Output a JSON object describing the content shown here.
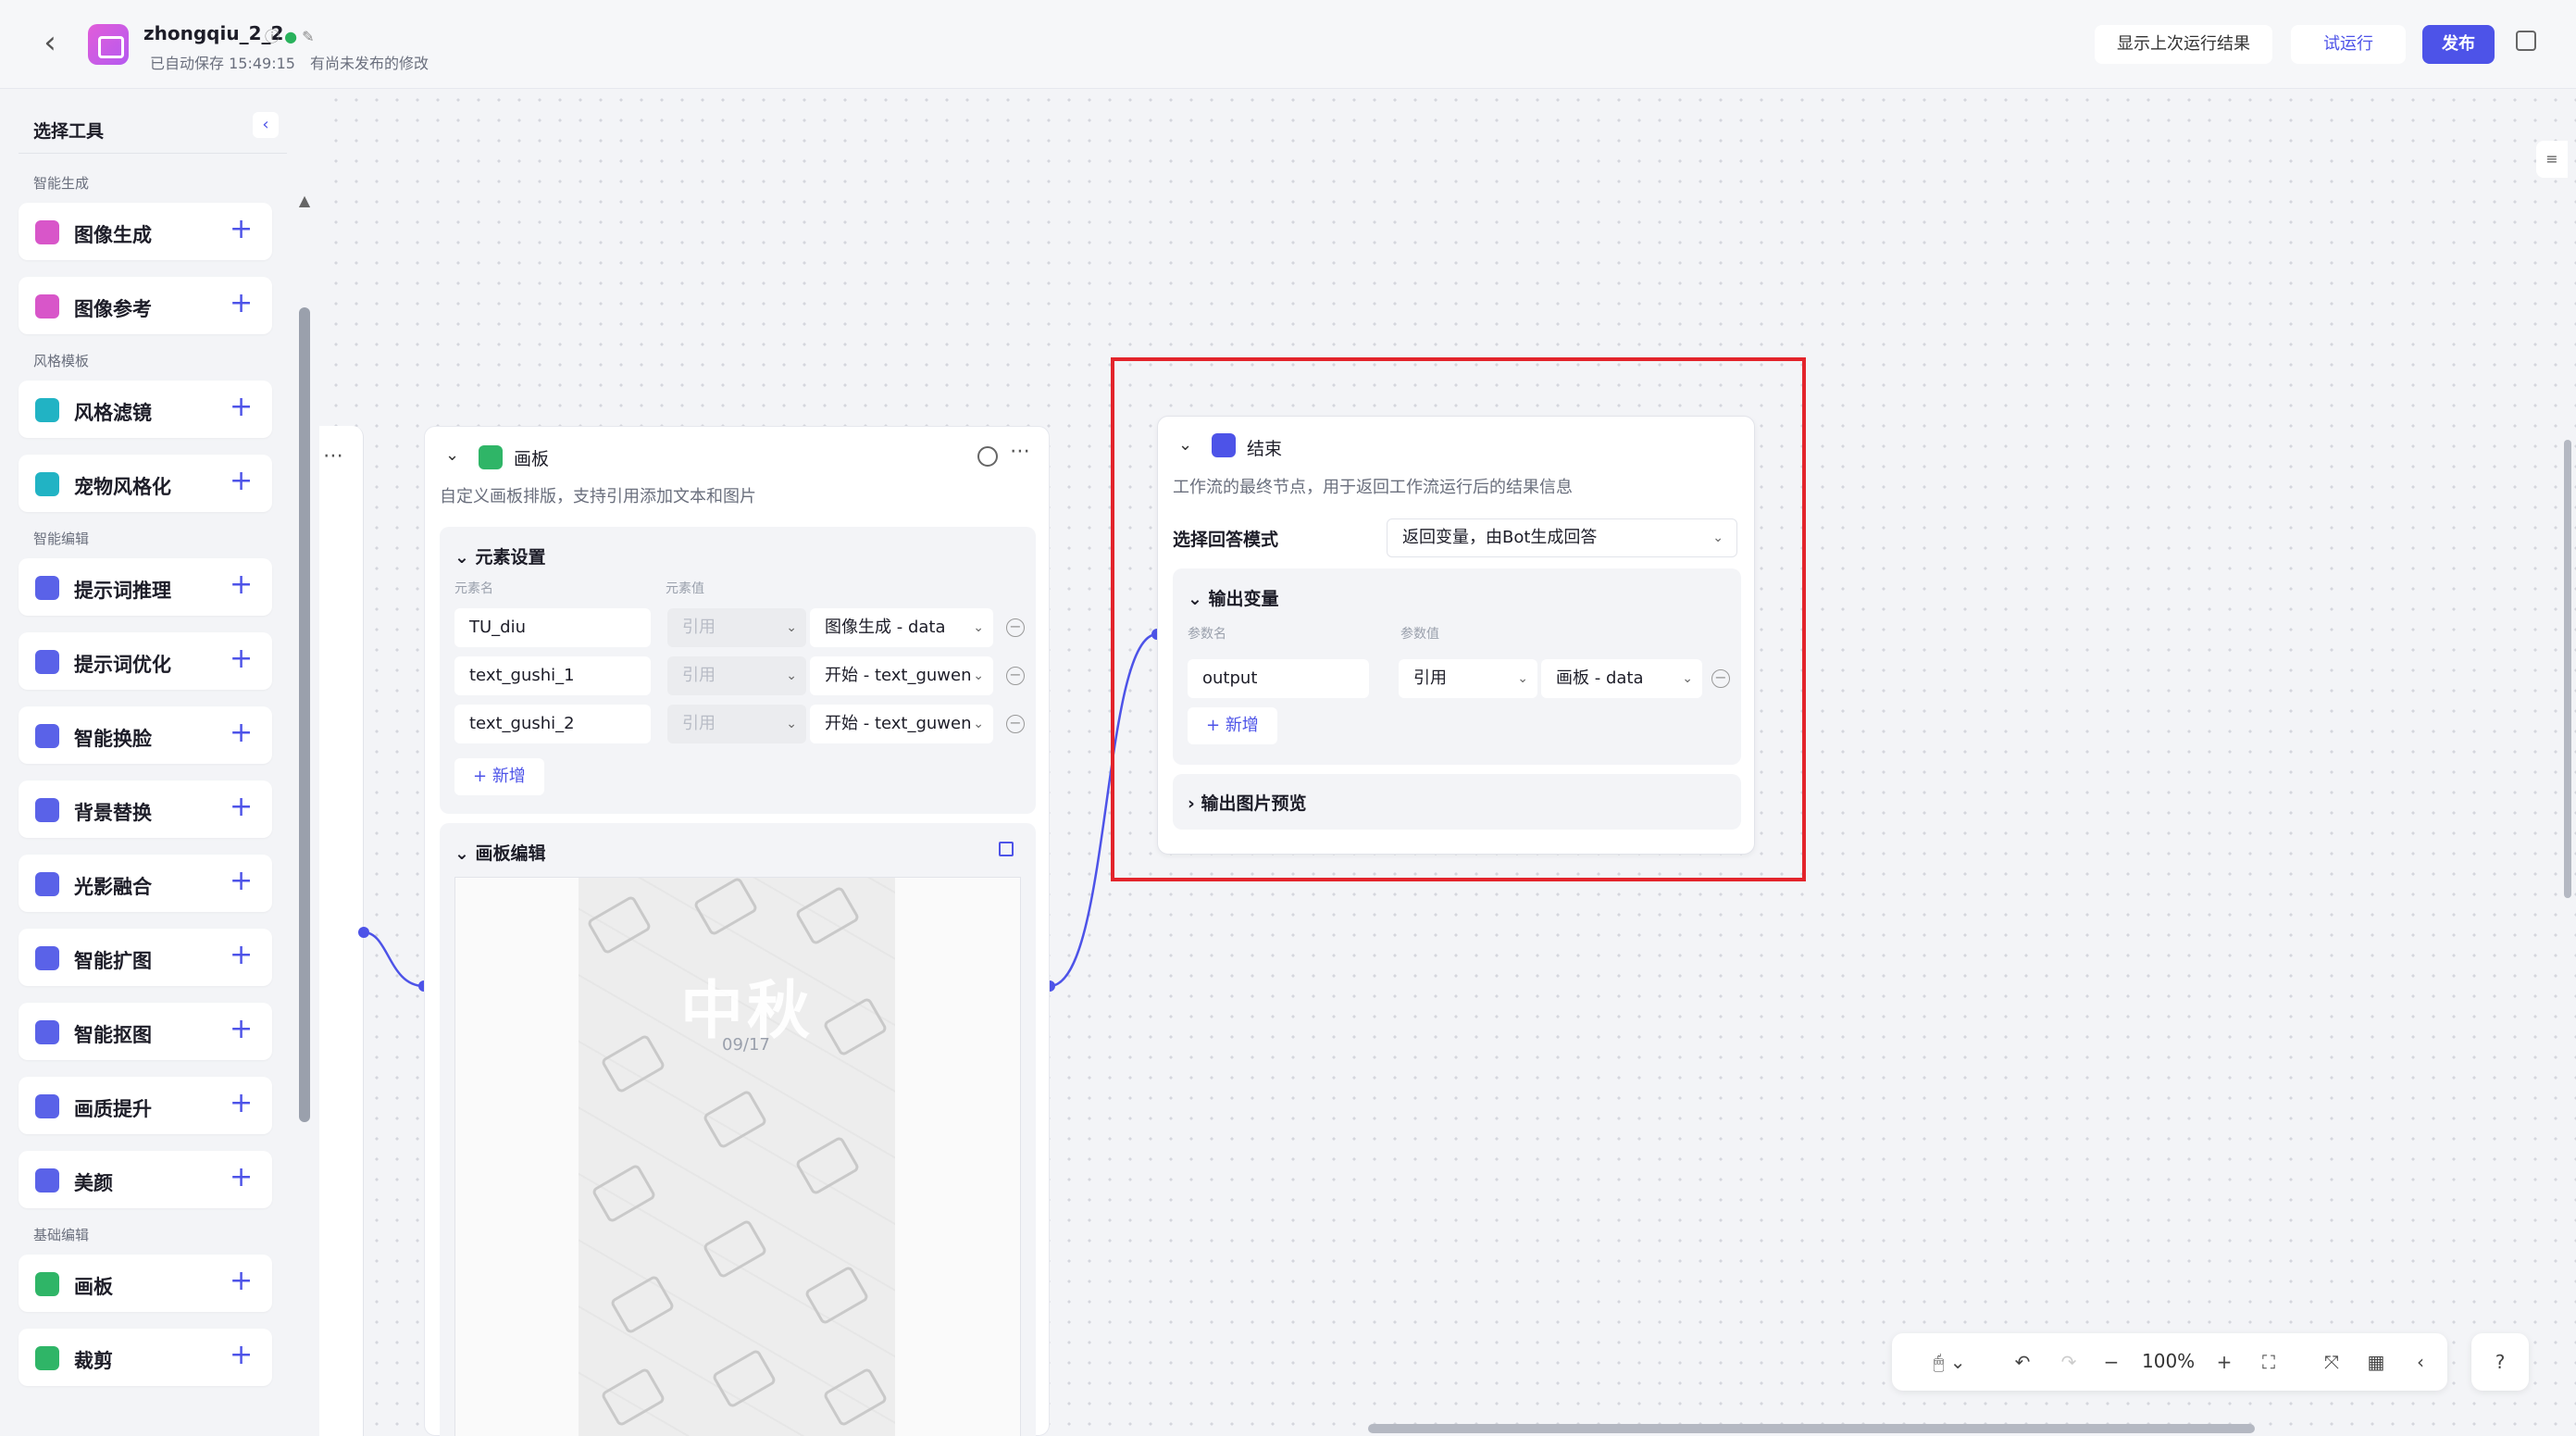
{
  "header": {
    "title": "zhongqiu_2_2",
    "autosave": "已自动保存 15:49:15",
    "unpublished": "有尚未发布的修改",
    "show_last_run": "显示上次运行结果",
    "test_run": "试运行",
    "publish": "发布"
  },
  "sidebar": {
    "title": "选择工具",
    "categories": [
      "智能生成",
      "风格模板",
      "智能编辑",
      "基础编辑"
    ],
    "tools": [
      {
        "label": "图像生成",
        "color": "#d856c9"
      },
      {
        "label": "图像参考",
        "color": "#d856c9"
      },
      {
        "label": "风格滤镜",
        "color": "#21b3c4"
      },
      {
        "label": "宠物风格化",
        "color": "#21b3c4"
      },
      {
        "label": "提示词推理",
        "color": "#5a62e8"
      },
      {
        "label": "提示词优化",
        "color": "#5a62e8"
      },
      {
        "label": "智能换脸",
        "color": "#5a62e8"
      },
      {
        "label": "背景替换",
        "color": "#5a62e8"
      },
      {
        "label": "光影融合",
        "color": "#5a62e8"
      },
      {
        "label": "智能扩图",
        "color": "#5a62e8"
      },
      {
        "label": "智能抠图",
        "color": "#5a62e8"
      },
      {
        "label": "画质提升",
        "color": "#5a62e8"
      },
      {
        "label": "美颜",
        "color": "#5a62e8"
      },
      {
        "label": "画板",
        "color": "#2fb567"
      },
      {
        "label": "裁剪",
        "color": "#2fb567"
      }
    ]
  },
  "board_node": {
    "title": "画板",
    "description": "自定义画板排版，支持引用添加文本和图片",
    "element_settings": "元素设置",
    "col_name": "元素名",
    "col_value": "元素值",
    "rows": [
      {
        "name": "TU_diu",
        "type": "引用",
        "value": "图像生成 - data"
      },
      {
        "name": "text_gushi_1",
        "type": "引用",
        "value": "开始 - text_guwen"
      },
      {
        "name": "text_gushi_2",
        "type": "引用",
        "value": "开始 - text_guwen"
      }
    ],
    "add": "新增",
    "board_edit": "画板编辑",
    "poster_title": "中秋",
    "poster_date": "09/17"
  },
  "end_node": {
    "title": "结束",
    "description": "工作流的最终节点，用于返回工作流运行后的结果信息",
    "mode_label": "选择回答模式",
    "mode_value": "返回变量，由Bot生成回答",
    "output_vars": "输出变量",
    "col_name": "参数名",
    "col_value": "参数值",
    "var_name": "output",
    "var_type": "引用",
    "var_value": "画板 - data",
    "add": "新增",
    "image_preview": "输出图片预览"
  },
  "controls": {
    "zoom": "100%"
  }
}
